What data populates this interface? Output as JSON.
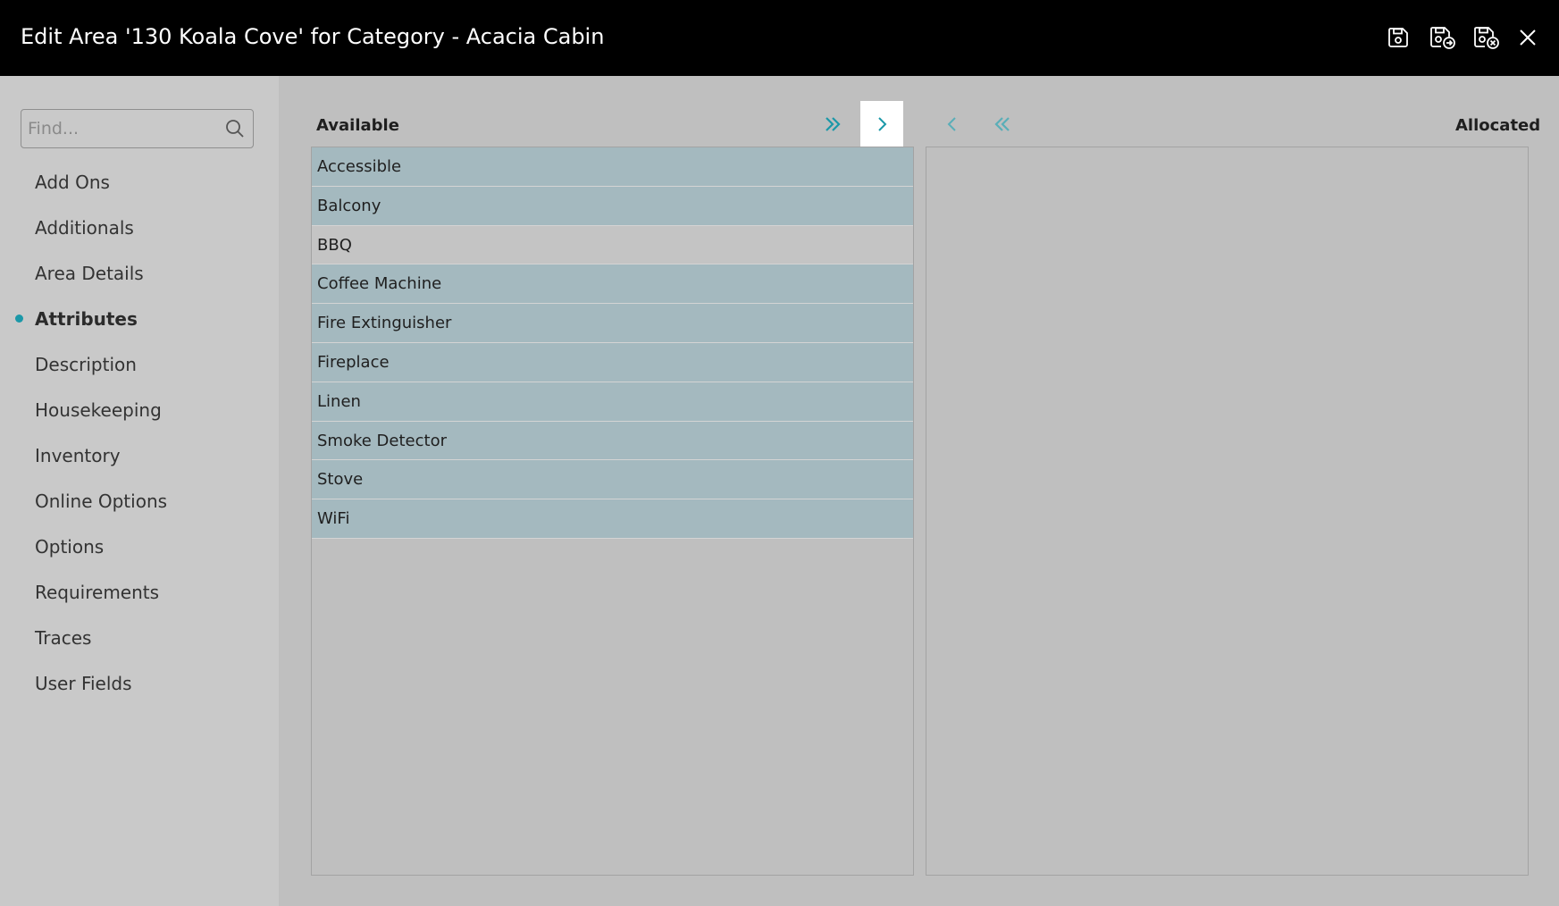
{
  "header": {
    "title": "Edit Area '130 Koala Cove' for Category - Acacia Cabin",
    "icons": [
      "save-icon",
      "save-and-new-icon",
      "save-and-close-icon",
      "close-icon"
    ]
  },
  "sidebar": {
    "search_placeholder": "Find...",
    "items": [
      {
        "label": "Add Ons",
        "active": false
      },
      {
        "label": "Additionals",
        "active": false
      },
      {
        "label": "Area Details",
        "active": false
      },
      {
        "label": "Attributes",
        "active": true
      },
      {
        "label": "Description",
        "active": false
      },
      {
        "label": "Housekeeping",
        "active": false
      },
      {
        "label": "Inventory",
        "active": false
      },
      {
        "label": "Online Options",
        "active": false
      },
      {
        "label": "Options",
        "active": false
      },
      {
        "label": "Requirements",
        "active": false
      },
      {
        "label": "Traces",
        "active": false
      },
      {
        "label": "User Fields",
        "active": false
      }
    ]
  },
  "main": {
    "available_label": "Available",
    "allocated_label": "Allocated",
    "accent_color": "#1b98a8",
    "available_items": [
      {
        "label": "Accessible",
        "selected": true
      },
      {
        "label": "Balcony",
        "selected": true
      },
      {
        "label": "BBQ",
        "selected": false
      },
      {
        "label": "Coffee Machine",
        "selected": true
      },
      {
        "label": "Fire Extinguisher",
        "selected": true
      },
      {
        "label": "Fireplace",
        "selected": true
      },
      {
        "label": "Linen",
        "selected": true
      },
      {
        "label": "Smoke Detector",
        "selected": true
      },
      {
        "label": "Stove",
        "selected": true
      },
      {
        "label": "WiFi",
        "selected": true
      }
    ],
    "allocated_items": []
  }
}
